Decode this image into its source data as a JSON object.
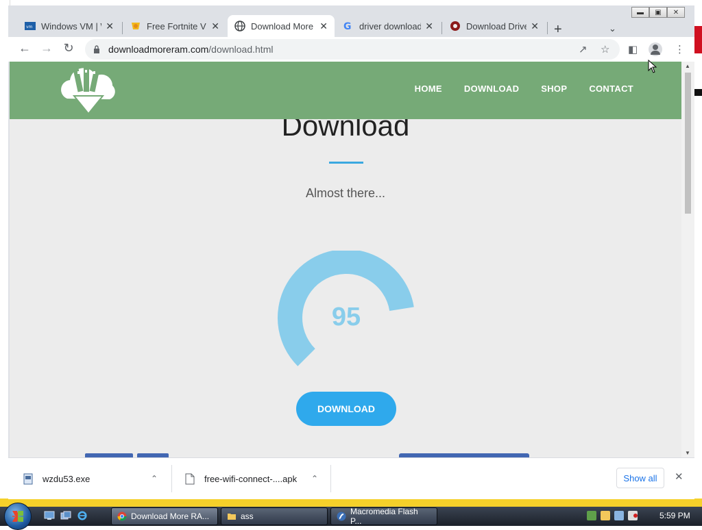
{
  "browser": {
    "tabs": [
      {
        "title": "Windows VM | W",
        "favicon": "vmware-icon",
        "active": false
      },
      {
        "title": "Free Fortnite V B",
        "favicon": "fortnite-icon",
        "active": false
      },
      {
        "title": "Download More",
        "favicon": "globe-icon",
        "active": true
      },
      {
        "title": "driver download",
        "favicon": "google-icon",
        "active": false
      },
      {
        "title": "Download Driver",
        "favicon": "driver-icon",
        "active": false
      }
    ],
    "url_host": "downloadmoreram.com",
    "url_path": "/download.html"
  },
  "site": {
    "nav": [
      "HOME",
      "DOWNLOAD",
      "SHOP",
      "CONTACT"
    ],
    "heading": "Download",
    "subheading": "Almost there...",
    "gauge_value": 95,
    "gauge_fraction": 0.8,
    "download_button": "DOWNLOAD",
    "accent": "#2fa9ec",
    "header_color": "#76aa77"
  },
  "downloads": {
    "items": [
      {
        "name": "wzdu53.exe",
        "icon": "exe-file-icon"
      },
      {
        "name": "free-wifi-connect-....apk",
        "icon": "file-icon"
      }
    ],
    "show_all": "Show all"
  },
  "taskbar": {
    "tasks": [
      {
        "label": "Download More RA...",
        "icon": "chrome-icon",
        "active": true
      },
      {
        "label": "ass",
        "icon": "folder-icon",
        "active": false
      },
      {
        "label": "Macromedia Flash P...",
        "icon": "flash-icon",
        "active": false
      }
    ],
    "clock": "5:59 PM"
  }
}
